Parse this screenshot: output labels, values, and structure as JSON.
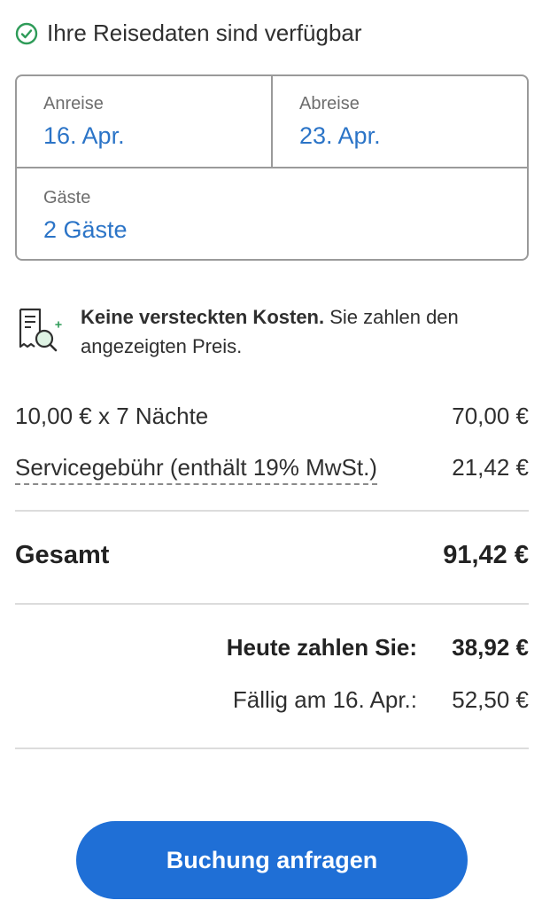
{
  "availability": {
    "icon": "check-circle-icon",
    "text": "Ihre Reisedaten sind verfügbar",
    "color": "#2e9b58"
  },
  "dates": {
    "checkin_label": "Anreise",
    "checkin_value": "16. Apr.",
    "checkout_label": "Abreise",
    "checkout_value": "23. Apr.",
    "guests_label": "Gäste",
    "guests_value": "2 Gäste",
    "value_color": "#2b74c7"
  },
  "notice": {
    "icon": "receipt-magnifier-icon",
    "bold": "Keine versteckten Kosten.",
    "text": " Sie zahlen den angezeigten Preis."
  },
  "price_lines": [
    {
      "label": "10,00 € x 7 Nächte",
      "amount": "70,00 €"
    },
    {
      "label": "Servicegebühr (enthält 19% MwSt.)",
      "amount": "21,42 €"
    }
  ],
  "total": {
    "label": "Gesamt",
    "amount": "91,42 €"
  },
  "payments": {
    "today_label": "Heute zahlen Sie:",
    "today_amount": "38,92 €",
    "due_label": "Fällig am 16. Apr.:",
    "due_amount": "52,50 €"
  },
  "cta": {
    "label": "Buchung anfragen",
    "color": "#1f6fd6"
  }
}
